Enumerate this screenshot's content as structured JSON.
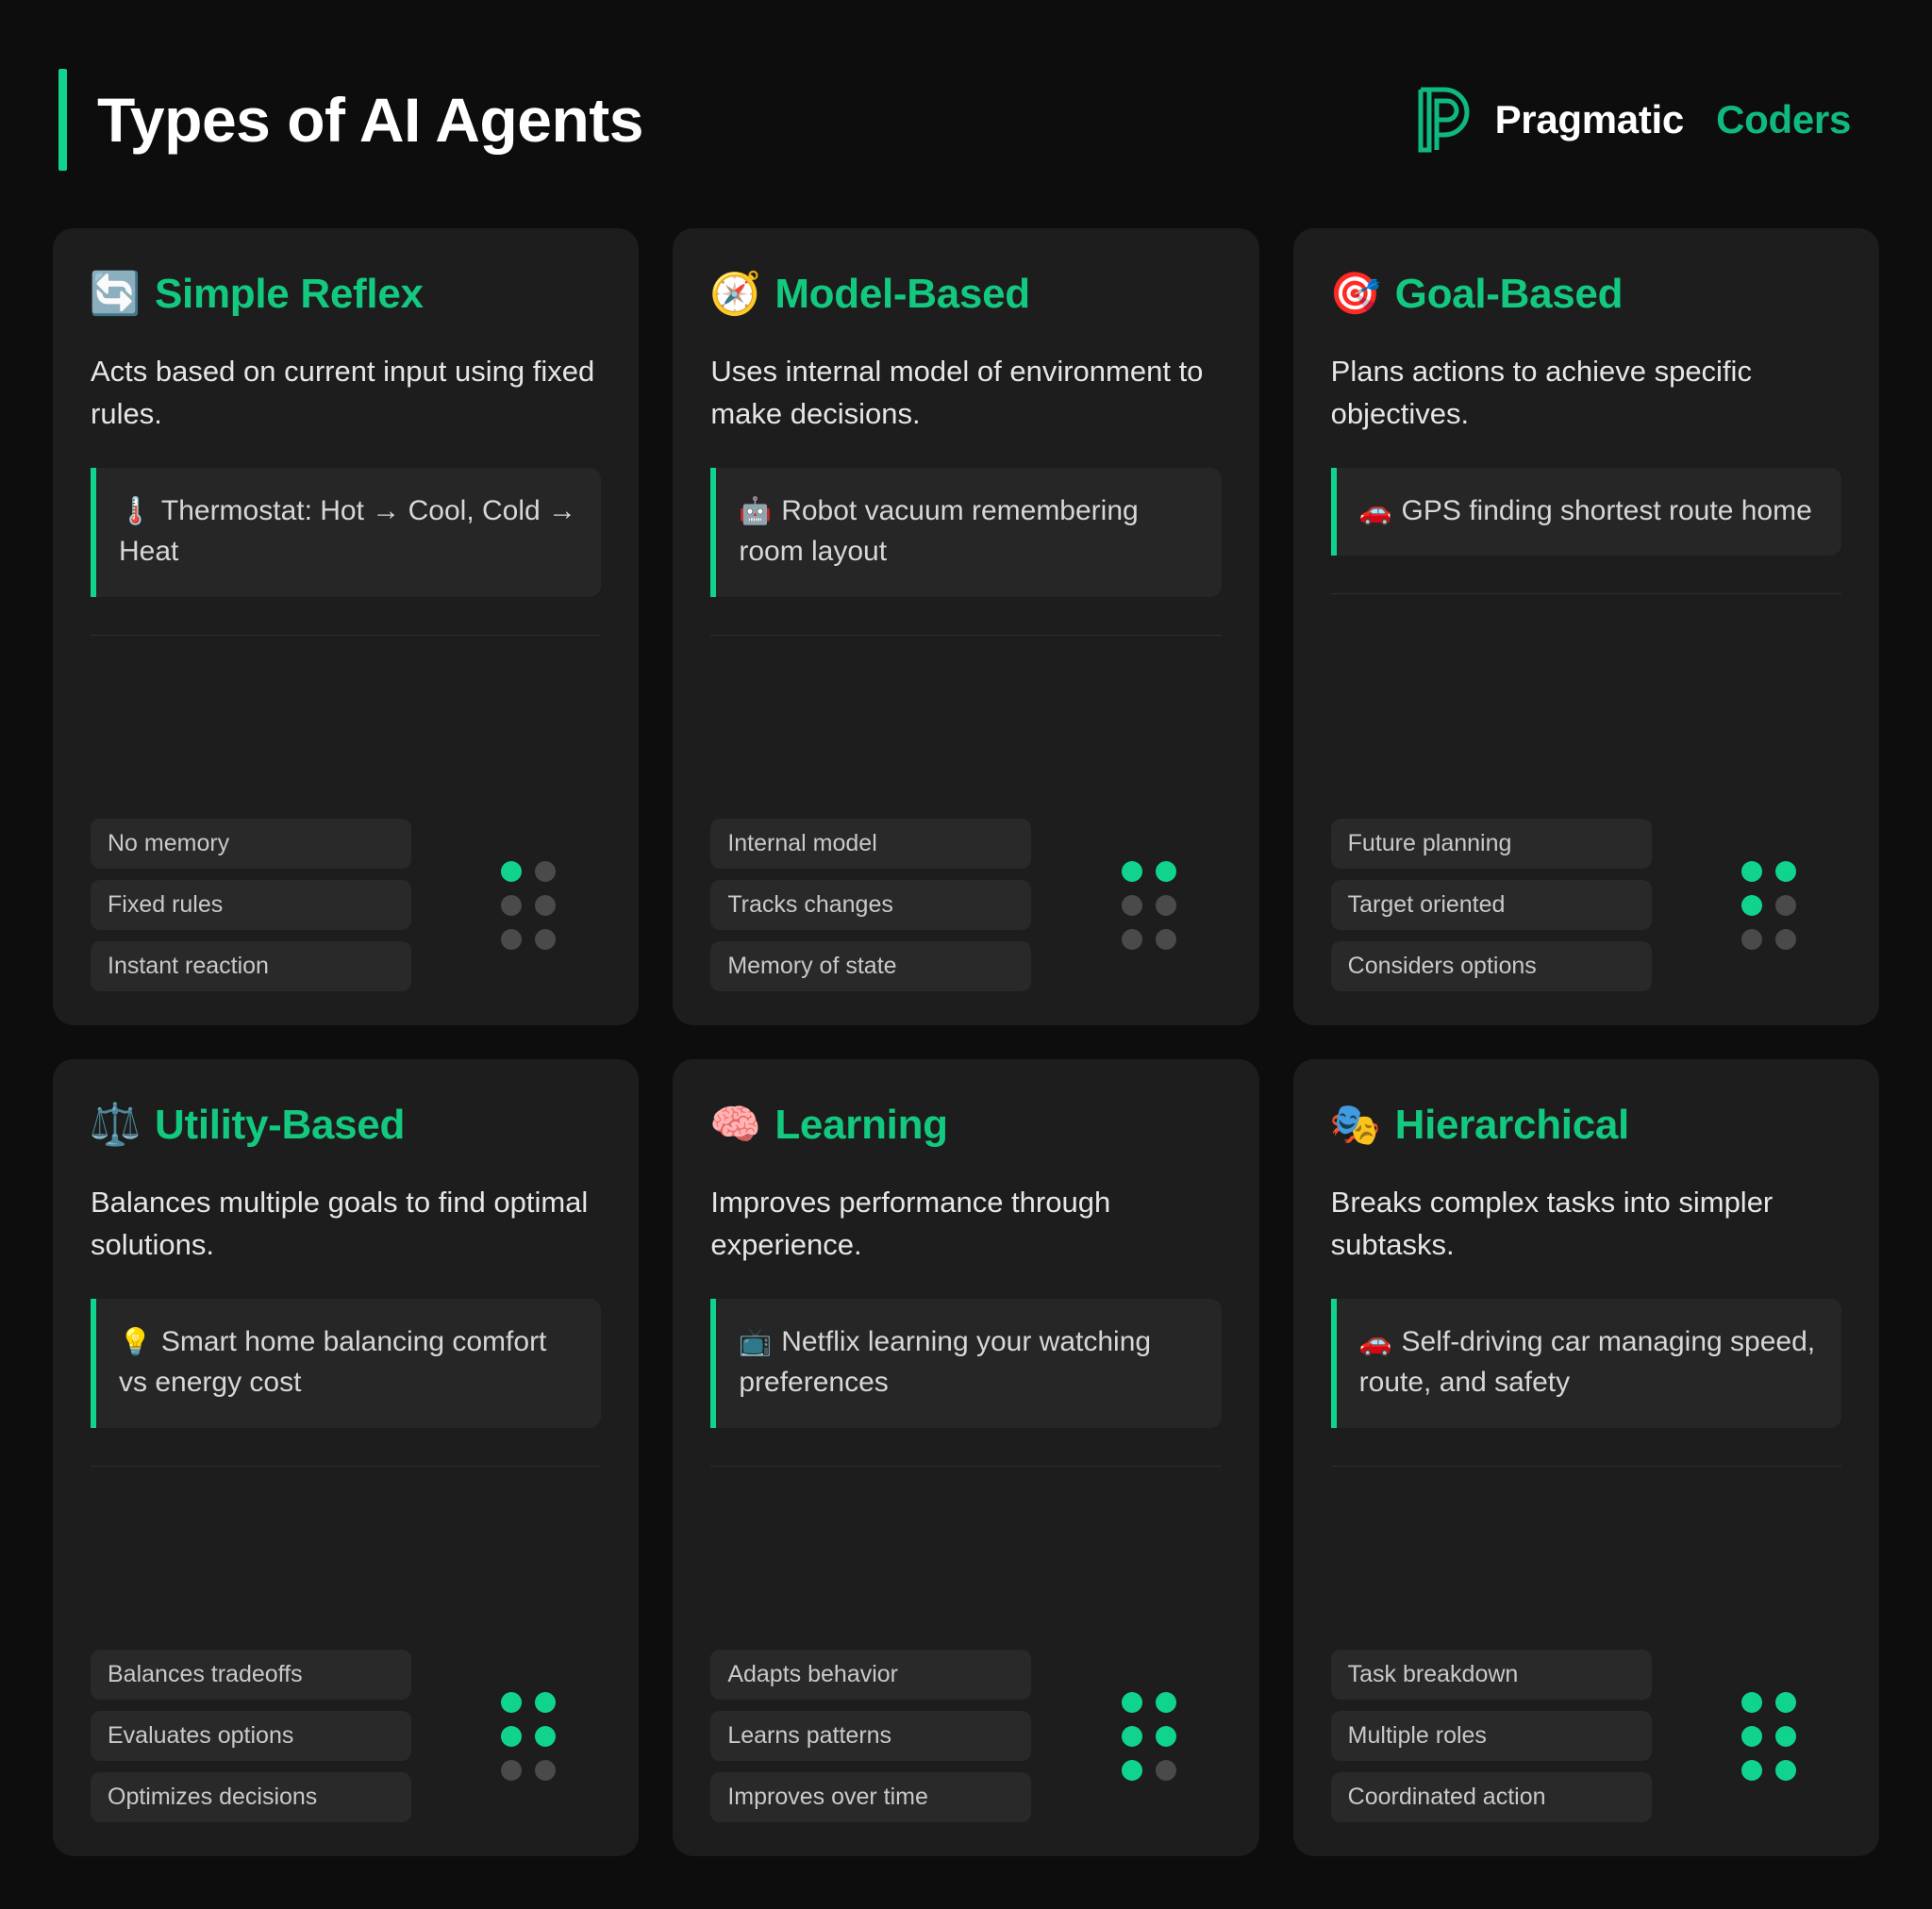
{
  "header": {
    "title": "Types of AI Agents",
    "brand_primary": "Pragmatic",
    "brand_secondary": "Coders",
    "accent_color": "#10d48e",
    "brand_green": "#10b981"
  },
  "cards": [
    {
      "emoji": "🔄",
      "icon_name": "refresh-arrows-icon",
      "title": "Simple Reflex",
      "description": "Acts based on current input using fixed rules.",
      "example_emoji": "🌡️",
      "example_icon_name": "thermometer-icon",
      "example": "Thermostat: Hot → Cool, Cold → Heat",
      "tags": [
        "No memory",
        "Fixed rules",
        "Instant reaction"
      ],
      "level": 1,
      "level_total": 6
    },
    {
      "emoji": "🧭",
      "icon_name": "compass-icon",
      "title": "Model-Based",
      "description": "Uses internal model of environment to make decisions.",
      "example_emoji": "🤖",
      "example_icon_name": "robot-icon",
      "example": "Robot vacuum remembering room layout",
      "tags": [
        "Internal model",
        "Tracks changes",
        "Memory of state"
      ],
      "level": 2,
      "level_total": 6
    },
    {
      "emoji": "🎯",
      "icon_name": "dart-target-icon",
      "title": "Goal-Based",
      "description": "Plans actions to achieve specific objectives.",
      "example_emoji": "🚗",
      "example_icon_name": "car-icon",
      "example": "GPS finding shortest route home",
      "tags": [
        "Future planning",
        "Target oriented",
        "Considers options"
      ],
      "level": 3,
      "level_total": 6
    },
    {
      "emoji": "⚖️",
      "icon_name": "balance-scale-icon",
      "title": "Utility-Based",
      "description": "Balances multiple goals to find optimal solutions.",
      "example_emoji": "💡",
      "example_icon_name": "lightbulb-icon",
      "example": "Smart home balancing comfort vs energy cost",
      "tags": [
        "Balances tradeoffs",
        "Evaluates options",
        "Optimizes decisions"
      ],
      "level": 4,
      "level_total": 6
    },
    {
      "emoji": "🧠",
      "icon_name": "brain-icon",
      "title": "Learning",
      "description": "Improves performance through experience.",
      "example_emoji": "📺",
      "example_icon_name": "television-icon",
      "example": "Netflix learning your watching preferences",
      "tags": [
        "Adapts behavior",
        "Learns patterns",
        "Improves over time"
      ],
      "level": 5,
      "level_total": 6
    },
    {
      "emoji": "🎭",
      "icon_name": "theater-masks-icon",
      "title": "Hierarchical",
      "description": "Breaks complex tasks into simpler subtasks.",
      "example_emoji": "🚗",
      "example_icon_name": "car-icon",
      "example": "Self-driving car managing speed, route, and safety",
      "tags": [
        "Task breakdown",
        "Multiple roles",
        "Coordinated action"
      ],
      "level": 6,
      "level_total": 6
    }
  ]
}
